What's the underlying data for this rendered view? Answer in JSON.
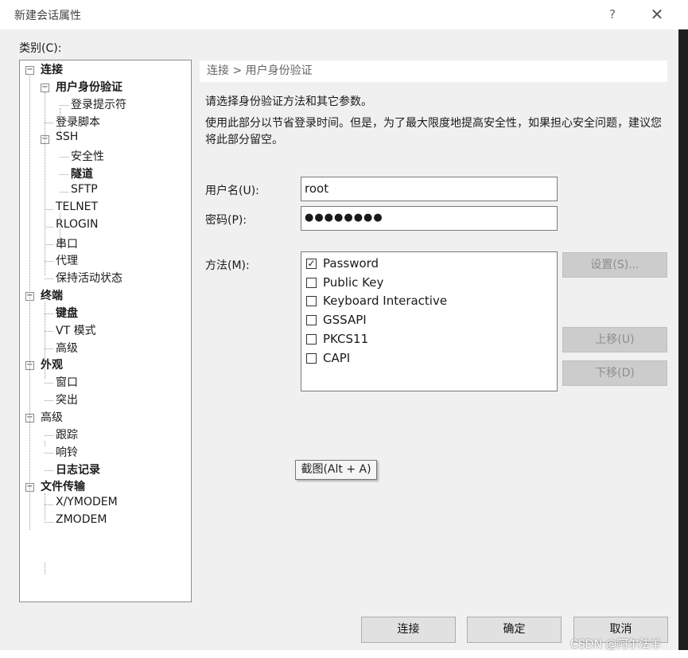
{
  "window": {
    "title": "新建会话属性",
    "help_glyph": "?",
    "close_glyph": "✕"
  },
  "category_label": "类别(C):",
  "tree": [
    {
      "label": "连接",
      "bold": true,
      "toggle": "−"
    },
    {
      "label": "用户身份验证",
      "bold": true,
      "toggle": "−"
    },
    {
      "label": "登录提示符",
      "bold": false
    },
    {
      "label": "登录脚本",
      "bold": false
    },
    {
      "label": "SSH",
      "bold": false,
      "toggle": "−"
    },
    {
      "label": "安全性",
      "bold": false
    },
    {
      "label": "隧道",
      "bold": true
    },
    {
      "label": "SFTP",
      "bold": false
    },
    {
      "label": "TELNET",
      "bold": false
    },
    {
      "label": "RLOGIN",
      "bold": false
    },
    {
      "label": "串口",
      "bold": false
    },
    {
      "label": "代理",
      "bold": false
    },
    {
      "label": "保持活动状态",
      "bold": false
    },
    {
      "label": "终端",
      "bold": true,
      "toggle": "−"
    },
    {
      "label": "键盘",
      "bold": true
    },
    {
      "label": "VT 模式",
      "bold": false
    },
    {
      "label": "高级",
      "bold": false
    },
    {
      "label": "外观",
      "bold": true,
      "toggle": "−"
    },
    {
      "label": "窗口",
      "bold": false
    },
    {
      "label": "突出",
      "bold": false
    },
    {
      "label": "高级",
      "bold": false,
      "toggle": "−"
    },
    {
      "label": "跟踪",
      "bold": false
    },
    {
      "label": "响铃",
      "bold": false
    },
    {
      "label": "日志记录",
      "bold": true
    },
    {
      "label": "文件传输",
      "bold": true,
      "toggle": "−"
    },
    {
      "label": "X/YMODEM",
      "bold": false
    },
    {
      "label": "ZMODEM",
      "bold": false
    }
  ],
  "breadcrumb": "连接 > 用户身份验证",
  "desc1": "请选择身份验证方法和其它参数。",
  "desc2": "使用此部分以节省登录时间。但是，为了最大限度地提高安全性，如果担心安全问题，建议您将此部分留空。",
  "username": {
    "label": "用户名(U):",
    "value": "root"
  },
  "password": {
    "label": "密码(P):",
    "value": "●●●●●●●●"
  },
  "method": {
    "label": "方法(M):",
    "options": [
      {
        "label": "Password",
        "checked": true
      },
      {
        "label": "Public Key",
        "checked": false
      },
      {
        "label": "Keyboard Interactive",
        "checked": false
      },
      {
        "label": "GSSAPI",
        "checked": false
      },
      {
        "label": "PKCS11",
        "checked": false
      },
      {
        "label": "CAPI",
        "checked": false
      }
    ],
    "check_glyph": "✓"
  },
  "buttons": {
    "settings": "设置(S)...",
    "move_up": "上移(U)",
    "move_down": "下移(D)",
    "connect": "连接",
    "ok": "确定",
    "cancel": "取消"
  },
  "tooltip": "截图(Alt + A)",
  "watermark": "CSDN @阿尔法羊"
}
